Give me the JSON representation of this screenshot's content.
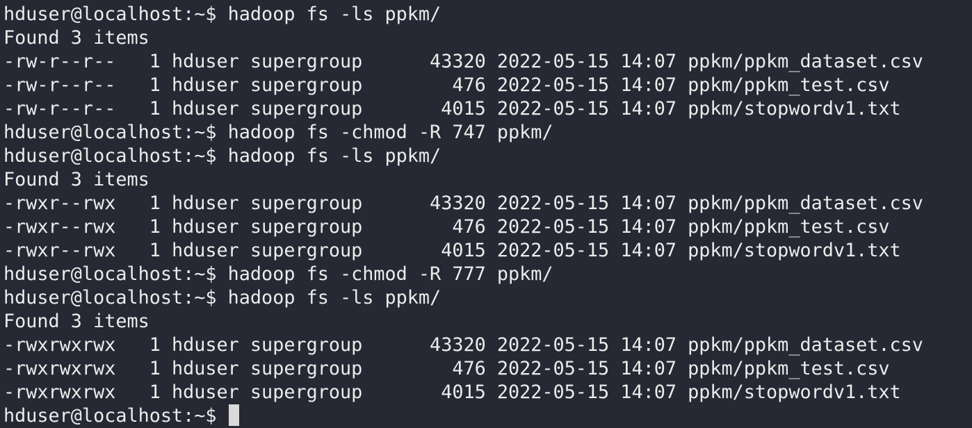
{
  "terminal": {
    "prompt": "hduser@localhost:~$ ",
    "lines": [
      "hduser@localhost:~$ hadoop fs -ls ppkm/",
      "Found 3 items",
      "-rw-r--r--   1 hduser supergroup      43320 2022-05-15 14:07 ppkm/ppkm_dataset.csv",
      "-rw-r--r--   1 hduser supergroup        476 2022-05-15 14:07 ppkm/ppkm_test.csv",
      "-rw-r--r--   1 hduser supergroup       4015 2022-05-15 14:07 ppkm/stopwordv1.txt",
      "hduser@localhost:~$ hadoop fs -chmod -R 747 ppkm/",
      "hduser@localhost:~$ hadoop fs -ls ppkm/",
      "Found 3 items",
      "-rwxr--rwx   1 hduser supergroup      43320 2022-05-15 14:07 ppkm/ppkm_dataset.csv",
      "-rwxr--rwx   1 hduser supergroup        476 2022-05-15 14:07 ppkm/ppkm_test.csv",
      "-rwxr--rwx   1 hduser supergroup       4015 2022-05-15 14:07 ppkm/stopwordv1.txt",
      "hduser@localhost:~$ hadoop fs -chmod -R 777 ppkm/",
      "hduser@localhost:~$ hadoop fs -ls ppkm/",
      "Found 3 items",
      "-rwxrwxrwx   1 hduser supergroup      43320 2022-05-15 14:07 ppkm/ppkm_dataset.csv",
      "-rwxrwxrwx   1 hduser supergroup        476 2022-05-15 14:07 ppkm/ppkm_test.csv",
      "-rwxrwxrwx   1 hduser supergroup       4015 2022-05-15 14:07 ppkm/stopwordv1.txt"
    ]
  }
}
